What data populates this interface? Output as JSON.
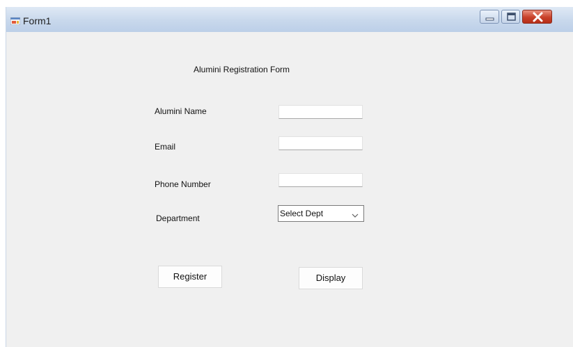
{
  "window": {
    "title": "Form1",
    "controls": {
      "minimize_icon": "minimize-icon",
      "maximize_icon": "maximize-icon",
      "close_icon": "close-icon"
    },
    "colors": {
      "titlebar": "#c8d8ec",
      "client": "#f0f0f0",
      "close_button": "#c8412a"
    }
  },
  "form": {
    "heading": "Alumini Registration Form",
    "fields": {
      "name": {
        "label": "Alumini Name",
        "value": "",
        "placeholder": ""
      },
      "email": {
        "label": "Email",
        "value": "",
        "placeholder": ""
      },
      "phone": {
        "label": "Phone Number",
        "value": "",
        "placeholder": ""
      }
    },
    "department": {
      "label": "Department",
      "selected": "Select Dept"
    },
    "buttons": {
      "register": "Register",
      "display": "Display"
    }
  }
}
